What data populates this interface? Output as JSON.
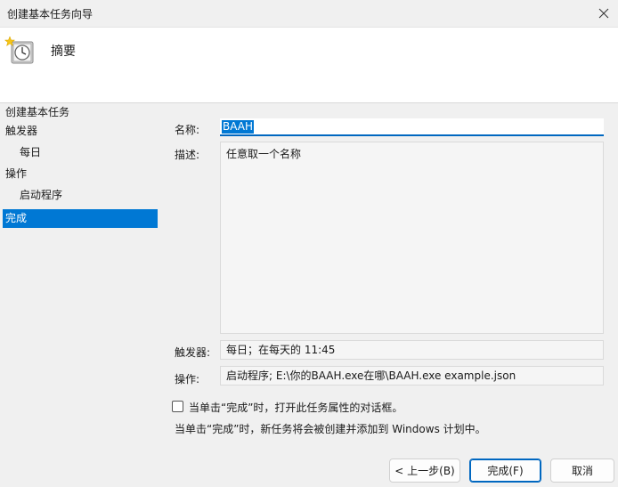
{
  "window": {
    "title": "创建基本任务向导"
  },
  "header": {
    "title": "摘要",
    "icon": "task-scheduler-clock-icon"
  },
  "steps": [
    {
      "label": "创建基本任务",
      "sub": false,
      "active": false
    },
    {
      "label": "触发器",
      "sub": false,
      "active": false
    },
    {
      "label": "每日",
      "sub": true,
      "active": false
    },
    {
      "label": "操作",
      "sub": false,
      "active": false
    },
    {
      "label": "启动程序",
      "sub": true,
      "active": false
    },
    {
      "label": "完成",
      "sub": false,
      "active": true
    }
  ],
  "form": {
    "name_label": "名称:",
    "name_value": "BAAH",
    "desc_label": "描述:",
    "desc_value": "任意取一个名称",
    "trigger_label": "触发器:",
    "trigger_value": "每日；在每天的 11:45",
    "action_label": "操作:",
    "action_value": "启动程序; E:\\你的BAAH.exe在哪\\BAAH.exe example.json"
  },
  "checkbox": {
    "label": "当单击“完成”时，打开此任务属性的对话框。",
    "checked": false
  },
  "info_text": "当单击“完成”时，新任务将会被创建并添加到 Windows 计划中。",
  "buttons": {
    "back": "< 上一步(B)",
    "finish": "完成(F)",
    "cancel": "取消"
  },
  "colors": {
    "accent": "#0078d4",
    "selection": "#0078d4"
  }
}
